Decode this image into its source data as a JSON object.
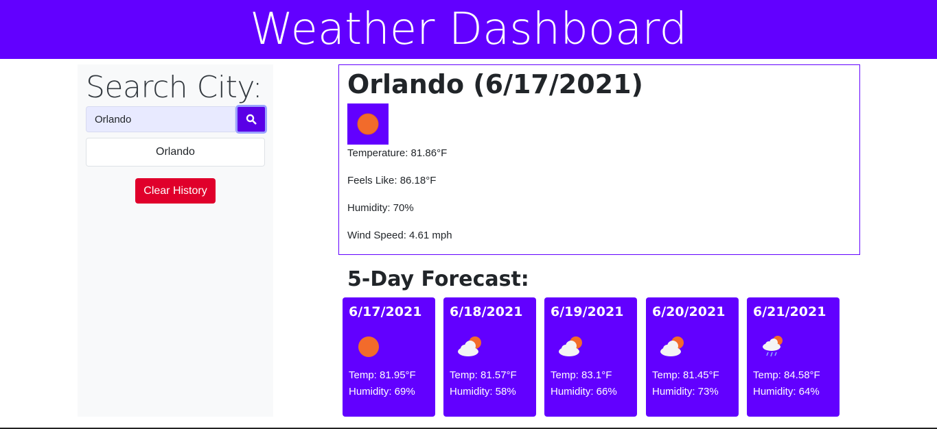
{
  "header": {
    "title": "Weather Dashboard"
  },
  "sidebar": {
    "title": "Search City:",
    "search": {
      "value": "Orlando",
      "icon": "search-icon"
    },
    "history": [
      "Orlando"
    ],
    "clear_label": "Clear History"
  },
  "current": {
    "heading": "Orlando (6/17/2021)",
    "icon": "sun-icon",
    "temperature": "Temperature: 81.86°F",
    "feels_like": "Feels Like: 86.18°F",
    "humidity": "Humidity: 70%",
    "wind": "Wind Speed: 4.61 mph"
  },
  "forecast": {
    "title": "5-Day Forecast:",
    "days": [
      {
        "date": "6/17/2021",
        "icon": "sun-icon",
        "temp": "Temp: 81.95°F",
        "humidity": "Humidity: 69%"
      },
      {
        "date": "6/18/2021",
        "icon": "partly-cloudy-icon",
        "temp": "Temp: 81.57°F",
        "humidity": "Humidity: 58%"
      },
      {
        "date": "6/19/2021",
        "icon": "partly-cloudy-icon",
        "temp": "Temp: 83.1°F",
        "humidity": "Humidity: 66%"
      },
      {
        "date": "6/20/2021",
        "icon": "partly-cloudy-icon",
        "temp": "Temp: 81.45°F",
        "humidity": "Humidity: 73%"
      },
      {
        "date": "6/21/2021",
        "icon": "rain-icon",
        "temp": "Temp: 84.58°F",
        "humidity": "Humidity: 64%"
      }
    ]
  },
  "colors": {
    "brand": "#6200ff",
    "danger": "#e0002b",
    "sun": "#f26b2b"
  }
}
